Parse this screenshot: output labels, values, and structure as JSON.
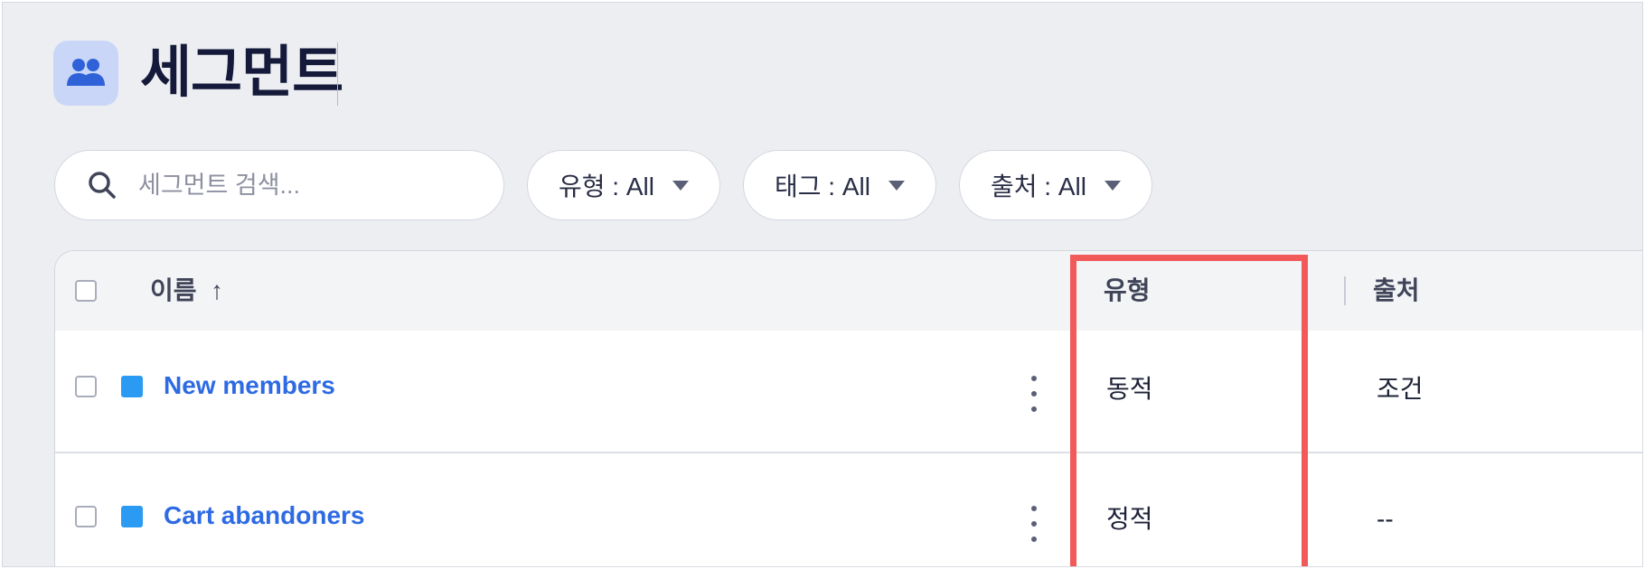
{
  "header": {
    "title": "세그먼트",
    "icon": "users-icon"
  },
  "filters": {
    "search_placeholder": "세그먼트 검색...",
    "type_filter": "유형 : All",
    "tag_filter": "태그 : All",
    "source_filter": "출처 : All"
  },
  "table": {
    "columns": {
      "name": "이름",
      "type": "유형",
      "source": "출처"
    },
    "sort_indicator": "↑",
    "rows": [
      {
        "name": "New members",
        "type": "동적",
        "source": "조건",
        "swatch_color": "#2b9af3"
      },
      {
        "name": "Cart abandoners",
        "type": "정적",
        "source": "--",
        "swatch_color": "#2b9af3"
      }
    ]
  },
  "colors": {
    "accent": "#2d6ae3",
    "highlight": "#f25a5a",
    "background": "#eceef2"
  }
}
